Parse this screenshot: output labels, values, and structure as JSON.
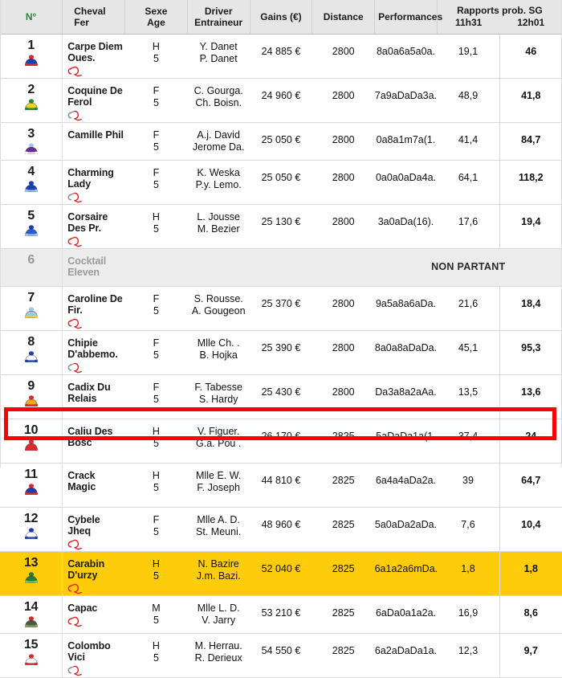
{
  "header": {
    "num": "N°",
    "cheval_l1": "Cheval",
    "cheval_l2": "Fer",
    "sexe_l1": "Sexe",
    "sexe_l2": "Age",
    "driver_l1": "Driver",
    "driver_l2": "Entraineur",
    "gains": "Gains (€)",
    "distance": "Distance",
    "performances": "Performances",
    "rapports_title": "Rapports prob. SG",
    "rapports_t1": "11h31",
    "rapports_t2": "12h01"
  },
  "colors": {
    "header_bg": "#e6e6e6",
    "num_header_green": "#1f8a2e",
    "highlight_yellow": "#fecc0a",
    "selection_red": "#ff0000",
    "non_partant_bg": "#ececec",
    "muted_text": "#9a9a9a"
  },
  "non_partant_label": "NON PARTANT",
  "rows": [
    {
      "num": "1",
      "horse": "Carpe Diem Oues.",
      "sexe": "H",
      "age": "5",
      "driver": "Y. Danet",
      "entraineur": "P. Danet",
      "gains": "24 885 €",
      "distance": "2800",
      "performances": "8a0a6a5a0a.",
      "r1": "19,1",
      "r2": "46",
      "silk": {
        "cap": "#d92b2b",
        "body": "#1b3fb0",
        "trim": "#d92b2b"
      },
      "shoe": "deferre-4"
    },
    {
      "num": "2",
      "horse": "Coquine De Ferol",
      "sexe": "F",
      "age": "5",
      "driver": "C. Gourga.",
      "entraineur": "Ch. Boisn.",
      "gains": "24 960 €",
      "distance": "2800",
      "performances": "7a9aDaDa3a.",
      "r1": "48,9",
      "r2": "41,8",
      "silk": {
        "cap": "#1f8a2e",
        "body": "#f2d21a",
        "trim": "#1f8a2e"
      },
      "shoe": "deferre-2"
    },
    {
      "num": "3",
      "horse": "Camille Phil",
      "sexe": "F",
      "age": "5",
      "driver": "A.j. David",
      "entraineur": "Jerome Da.",
      "gains": "25 050 €",
      "distance": "2800",
      "performances": "0a8a1m7a(1.",
      "r1": "41,4",
      "r2": "84,7",
      "silk": {
        "cap": "#9ec8e8",
        "body": "#6b2d8f",
        "trim": "#ffffff"
      },
      "shoe": ""
    },
    {
      "num": "4",
      "horse": "Charming Lady",
      "sexe": "F",
      "age": "5",
      "driver": "K. Weska",
      "entraineur": "P.y. Lemo.",
      "gains": "25 050 €",
      "distance": "2800",
      "performances": "0a0a0aDa4a.",
      "r1": "64,1",
      "r2": "118,2",
      "silk": {
        "cap": "#1b3fb0",
        "body": "#1b3fb0",
        "trim": "#9ec8e8"
      },
      "shoe": "deferre-2"
    },
    {
      "num": "5",
      "horse": "Corsaire Des Pr.",
      "sexe": "H",
      "age": "5",
      "driver": "L. Jousse",
      "entraineur": "M. Bezier",
      "gains": "25 130 €",
      "distance": "2800",
      "performances": "3a0aDa(16).",
      "r1": "17,6",
      "r2": "19,4",
      "silk": {
        "cap": "#1b3fb0",
        "body": "#2a5fd0",
        "trim": "#9ec8e8"
      },
      "shoe": "deferre-4"
    },
    {
      "num": "6",
      "horse": "Cocktail Eleven",
      "sexe": "",
      "age": "",
      "driver": "",
      "entraineur": "",
      "gains": "",
      "distance": "",
      "performances": "",
      "r1": "",
      "r2": "",
      "silk": null,
      "shoe": "",
      "non_partant": true
    },
    {
      "num": "7",
      "horse": "Caroline De Fir.",
      "sexe": "F",
      "age": "5",
      "driver": "S. Rousse.",
      "entraineur": "A. Gougeon",
      "gains": "25 370 €",
      "distance": "2800",
      "performances": "9a5a8a6aDa.",
      "r1": "21,6",
      "r2": "18,4",
      "silk": {
        "cap": "#9ec8e8",
        "body": "#9ec8e8",
        "trim": "#f2d21a"
      },
      "shoe": "deferre-4"
    },
    {
      "num": "8",
      "horse": "Chipie D'abbemo.",
      "sexe": "F",
      "age": "5",
      "driver": "Mlle Ch. .",
      "entraineur": "B. Hojka",
      "gains": "25 390 €",
      "distance": "2800",
      "performances": "8a0a8aDaDa.",
      "r1": "45,1",
      "r2": "95,3",
      "silk": {
        "cap": "#1b3fb0",
        "body": "#ffffff",
        "trim": "#1b3fb0"
      },
      "shoe": "deferre-2"
    },
    {
      "num": "9",
      "horse": "Cadix Du Relais",
      "sexe": "F",
      "age": "5",
      "driver": "F. Tabesse",
      "entraineur": "S. Hardy",
      "gains": "25 430 €",
      "distance": "2800",
      "performances": "Da3a8a2aAa.",
      "r1": "13,5",
      "r2": "13,6",
      "silk": {
        "cap": "#d92b2b",
        "body": "#f2a81a",
        "trim": "#d92b2b"
      },
      "shoe": ""
    },
    {
      "num": "10",
      "horse": "Caliu Des Bosc",
      "sexe": "H",
      "age": "5",
      "driver": "V. Figuer.",
      "entraineur": "G.a. Pou .",
      "gains": "26 170 €",
      "distance": "2825",
      "performances": "5aDaDa1a(1.",
      "r1": "37,4",
      "r2": "24",
      "silk": {
        "cap": "#d92b2b",
        "body": "#d92b2b",
        "trim": "#d92b2b"
      },
      "shoe": ""
    },
    {
      "num": "11",
      "horse": "Crack Magic",
      "sexe": "H",
      "age": "5",
      "driver": "Mlle E. W.",
      "entraineur": "F. Joseph",
      "gains": "44 810 €",
      "distance": "2825",
      "performances": "6a4a4aDa2a.",
      "r1": "39",
      "r2": "64,7",
      "silk": {
        "cap": "#d92b2b",
        "body": "#1b3fb0",
        "trim": "#d92b2b"
      },
      "shoe": ""
    },
    {
      "num": "12",
      "horse": "Cybele Jheq",
      "sexe": "F",
      "age": "5",
      "driver": "Mlle A. D.",
      "entraineur": "St. Meuni.",
      "gains": "48 960 €",
      "distance": "2825",
      "performances": "5a0aDa2aDa.",
      "r1": "7,6",
      "r2": "10,4",
      "silk": {
        "cap": "#1b3fb0",
        "body": "#ffffff",
        "trim": "#1b3fb0"
      },
      "shoe": "deferre-4"
    },
    {
      "num": "13",
      "horse": "Carabin D'urzy",
      "sexe": "H",
      "age": "5",
      "driver": "N. Bazire",
      "entraineur": "J.m. Bazi.",
      "gains": "52 040 €",
      "distance": "2825",
      "performances": "6a1a2a6mDa.",
      "r1": "1,8",
      "r2": "1,8",
      "silk": {
        "cap": "#2a7a33",
        "body": "#2a7a33",
        "trim": "#7ec27e"
      },
      "shoe": "deferre-4",
      "highlight": true
    },
    {
      "num": "14",
      "horse": "Capac",
      "sexe": "M",
      "age": "5",
      "driver": "Mlle L. D.",
      "entraineur": "V. Jarry",
      "gains": "53 210 €",
      "distance": "2825",
      "performances": "6aDa0a1a2a.",
      "r1": "16,9",
      "r2": "8,6",
      "silk": {
        "cap": "#d92b2b",
        "body": "#4a5a3a",
        "trim": "#8a9a6a"
      },
      "shoe": "deferre-4",
      "selected": true
    },
    {
      "num": "15",
      "horse": "Colombo Vici",
      "sexe": "H",
      "age": "5",
      "driver": "M. Herrau.",
      "entraineur": "R. Derieux",
      "gains": "54 550 €",
      "distance": "2825",
      "performances": "6a2aDaDa1a.",
      "r1": "12,3",
      "r2": "9,7",
      "silk": {
        "cap": "#d92b2b",
        "body": "#ffffff",
        "trim": "#d92b2b"
      },
      "shoe": "deferre-2"
    }
  ]
}
